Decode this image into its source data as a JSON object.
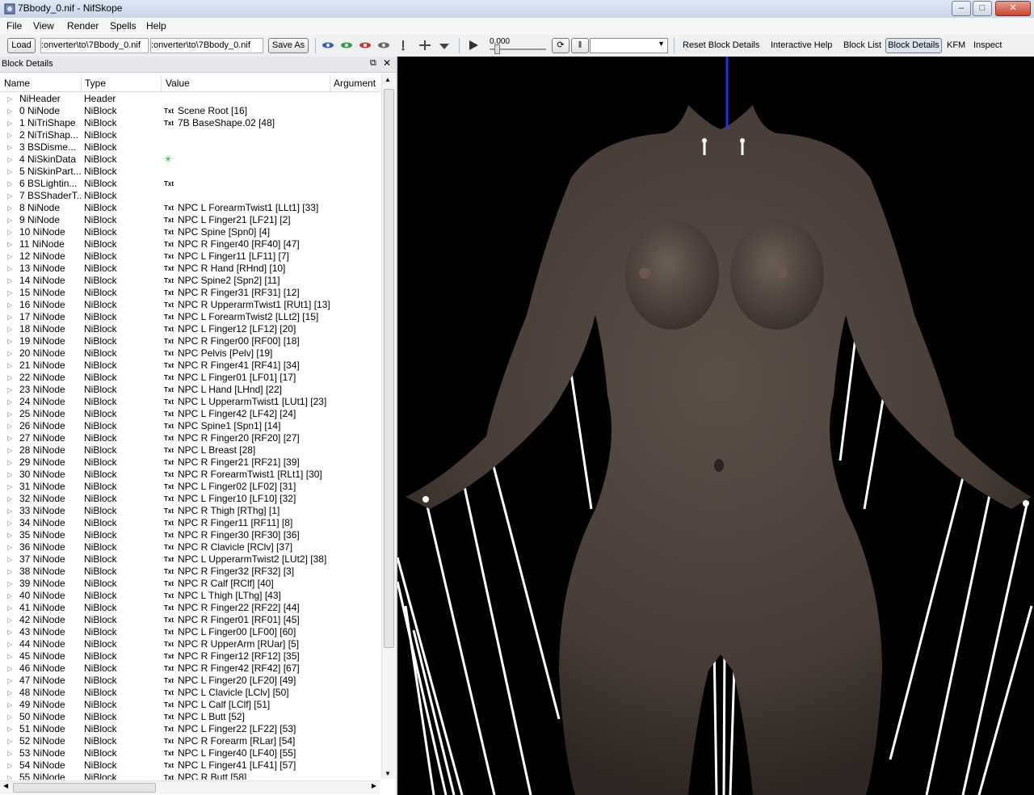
{
  "window": {
    "title": "7Bbody_0.nif - NifSkope"
  },
  "menu": [
    "File",
    "View",
    "Render",
    "Spells",
    "Help"
  ],
  "toolbar": {
    "load_label": "Load",
    "load_path": ":onverter\\to\\7Bbody_0.nif",
    "save_path": ":onverter\\to\\7Bbody_0.nif",
    "save_as_label": "Save As",
    "time_value": "0.000",
    "reset_label": "Reset Block Details",
    "help_label": "Interactive Help",
    "block_list_label": "Block List",
    "block_details_label": "Block Details",
    "kfm_label": "KFM",
    "inspect_label": "Inspect"
  },
  "panel": {
    "title": "Block Details",
    "columns": [
      "Name",
      "Type",
      "Value",
      "Argument"
    ]
  },
  "rows": [
    {
      "name": "NiHeader",
      "type": "Header",
      "value": "",
      "txt": false
    },
    {
      "name": "0 NiNode",
      "type": "NiBlock",
      "value": "Scene Root [16]",
      "txt": true
    },
    {
      "name": "1 NiTriShape",
      "type": "NiBlock",
      "value": "7B BaseShape.02 [48]",
      "txt": true
    },
    {
      "name": "2 NiTriShap...",
      "type": "NiBlock",
      "value": "",
      "txt": false
    },
    {
      "name": "3 BSDisme...",
      "type": "NiBlock",
      "value": "",
      "txt": false
    },
    {
      "name": "4 NiSkinData",
      "type": "NiBlock",
      "value": "",
      "txt": false,
      "axes": true
    },
    {
      "name": "5 NiSkinPart...",
      "type": "NiBlock",
      "value": "",
      "txt": false
    },
    {
      "name": "6 BSLightin...",
      "type": "NiBlock",
      "value": "",
      "txt": true
    },
    {
      "name": "7 BSShaderT...",
      "type": "NiBlock",
      "value": "",
      "txt": false
    },
    {
      "name": "8 NiNode",
      "type": "NiBlock",
      "value": "NPC L ForearmTwist1 [LLt1] [33]",
      "txt": true
    },
    {
      "name": "9 NiNode",
      "type": "NiBlock",
      "value": "NPC L Finger21 [LF21] [2]",
      "txt": true
    },
    {
      "name": "10 NiNode",
      "type": "NiBlock",
      "value": "NPC Spine [Spn0] [4]",
      "txt": true
    },
    {
      "name": "11 NiNode",
      "type": "NiBlock",
      "value": "NPC R Finger40 [RF40] [47]",
      "txt": true
    },
    {
      "name": "12 NiNode",
      "type": "NiBlock",
      "value": "NPC L Finger11 [LF11] [7]",
      "txt": true
    },
    {
      "name": "13 NiNode",
      "type": "NiBlock",
      "value": "NPC R Hand [RHnd] [10]",
      "txt": true
    },
    {
      "name": "14 NiNode",
      "type": "NiBlock",
      "value": "NPC Spine2 [Spn2] [11]",
      "txt": true
    },
    {
      "name": "15 NiNode",
      "type": "NiBlock",
      "value": "NPC R Finger31 [RF31] [12]",
      "txt": true
    },
    {
      "name": "16 NiNode",
      "type": "NiBlock",
      "value": "NPC R UpperarmTwist1 [RUt1] [13]",
      "txt": true
    },
    {
      "name": "17 NiNode",
      "type": "NiBlock",
      "value": "NPC L ForearmTwist2 [LLt2] [15]",
      "txt": true
    },
    {
      "name": "18 NiNode",
      "type": "NiBlock",
      "value": "NPC L Finger12 [LF12] [20]",
      "txt": true
    },
    {
      "name": "19 NiNode",
      "type": "NiBlock",
      "value": "NPC R Finger00 [RF00] [18]",
      "txt": true
    },
    {
      "name": "20 NiNode",
      "type": "NiBlock",
      "value": "NPC Pelvis [Pelv] [19]",
      "txt": true
    },
    {
      "name": "21 NiNode",
      "type": "NiBlock",
      "value": "NPC R Finger41 [RF41] [34]",
      "txt": true
    },
    {
      "name": "22 NiNode",
      "type": "NiBlock",
      "value": "NPC L Finger01 [LF01] [17]",
      "txt": true
    },
    {
      "name": "23 NiNode",
      "type": "NiBlock",
      "value": "NPC L Hand [LHnd] [22]",
      "txt": true
    },
    {
      "name": "24 NiNode",
      "type": "NiBlock",
      "value": "NPC L UpperarmTwist1 [LUt1] [23]",
      "txt": true
    },
    {
      "name": "25 NiNode",
      "type": "NiBlock",
      "value": "NPC L Finger42 [LF42] [24]",
      "txt": true
    },
    {
      "name": "26 NiNode",
      "type": "NiBlock",
      "value": "NPC Spine1 [Spn1] [14]",
      "txt": true
    },
    {
      "name": "27 NiNode",
      "type": "NiBlock",
      "value": "NPC R Finger20 [RF20] [27]",
      "txt": true
    },
    {
      "name": "28 NiNode",
      "type": "NiBlock",
      "value": "NPC L Breast [28]",
      "txt": true
    },
    {
      "name": "29 NiNode",
      "type": "NiBlock",
      "value": "NPC R Finger21 [RF21] [39]",
      "txt": true
    },
    {
      "name": "30 NiNode",
      "type": "NiBlock",
      "value": "NPC R ForearmTwist1 [RLt1] [30]",
      "txt": true
    },
    {
      "name": "31 NiNode",
      "type": "NiBlock",
      "value": "NPC L Finger02 [LF02] [31]",
      "txt": true
    },
    {
      "name": "32 NiNode",
      "type": "NiBlock",
      "value": "NPC L Finger10 [LF10] [32]",
      "txt": true
    },
    {
      "name": "33 NiNode",
      "type": "NiBlock",
      "value": "NPC R Thigh [RThg] [1]",
      "txt": true
    },
    {
      "name": "34 NiNode",
      "type": "NiBlock",
      "value": "NPC R Finger11 [RF11] [8]",
      "txt": true
    },
    {
      "name": "35 NiNode",
      "type": "NiBlock",
      "value": "NPC R Finger30 [RF30] [36]",
      "txt": true
    },
    {
      "name": "36 NiNode",
      "type": "NiBlock",
      "value": "NPC R Clavicle [RClv] [37]",
      "txt": true
    },
    {
      "name": "37 NiNode",
      "type": "NiBlock",
      "value": "NPC L UpperarmTwist2 [LUt2] [38]",
      "txt": true
    },
    {
      "name": "38 NiNode",
      "type": "NiBlock",
      "value": "NPC R Finger32 [RF32] [3]",
      "txt": true
    },
    {
      "name": "39 NiNode",
      "type": "NiBlock",
      "value": "NPC R Calf [RClf] [40]",
      "txt": true
    },
    {
      "name": "40 NiNode",
      "type": "NiBlock",
      "value": "NPC L Thigh [LThg] [43]",
      "txt": true
    },
    {
      "name": "41 NiNode",
      "type": "NiBlock",
      "value": "NPC R Finger22 [RF22] [44]",
      "txt": true
    },
    {
      "name": "42 NiNode",
      "type": "NiBlock",
      "value": "NPC R Finger01 [RF01] [45]",
      "txt": true
    },
    {
      "name": "43 NiNode",
      "type": "NiBlock",
      "value": "NPC L Finger00 [LF00] [60]",
      "txt": true
    },
    {
      "name": "44 NiNode",
      "type": "NiBlock",
      "value": "NPC R UpperArm [RUar] [5]",
      "txt": true
    },
    {
      "name": "45 NiNode",
      "type": "NiBlock",
      "value": "NPC R Finger12 [RF12] [35]",
      "txt": true
    },
    {
      "name": "46 NiNode",
      "type": "NiBlock",
      "value": "NPC R Finger42 [RF42] [67]",
      "txt": true
    },
    {
      "name": "47 NiNode",
      "type": "NiBlock",
      "value": "NPC L Finger20 [LF20] [49]",
      "txt": true
    },
    {
      "name": "48 NiNode",
      "type": "NiBlock",
      "value": "NPC L Clavicle [LClv] [50]",
      "txt": true
    },
    {
      "name": "49 NiNode",
      "type": "NiBlock",
      "value": "NPC L Calf [LClf] [51]",
      "txt": true
    },
    {
      "name": "50 NiNode",
      "type": "NiBlock",
      "value": "NPC L Butt [52]",
      "txt": true
    },
    {
      "name": "51 NiNode",
      "type": "NiBlock",
      "value": "NPC L Finger22 [LF22] [53]",
      "txt": true
    },
    {
      "name": "52 NiNode",
      "type": "NiBlock",
      "value": "NPC R Forearm [RLar] [54]",
      "txt": true
    },
    {
      "name": "53 NiNode",
      "type": "NiBlock",
      "value": "NPC L Finger40 [LF40] [55]",
      "txt": true
    },
    {
      "name": "54 NiNode",
      "type": "NiBlock",
      "value": "NPC L Finger41 [LF41] [57]",
      "txt": true
    },
    {
      "name": "55 NiNode",
      "type": "NiBlock",
      "value": "NPC R Butt [58]",
      "txt": true
    }
  ],
  "txt_badge": "Txt",
  "colors": {
    "viewport_bg": "#000000",
    "skin": "#4a3f39",
    "bone_lines": "#ffffff",
    "axis": "#2233dd"
  }
}
